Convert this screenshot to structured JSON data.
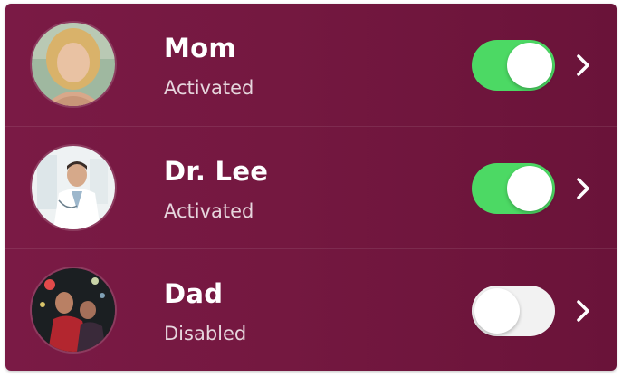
{
  "contacts": [
    {
      "name": "Mom",
      "status": "Activated",
      "enabled": true,
      "avatar_icon": "woman-portrait-icon"
    },
    {
      "name": "Dr. Lee",
      "status": "Activated",
      "enabled": true,
      "avatar_icon": "doctor-portrait-icon"
    },
    {
      "name": "Dad",
      "status": "Disabled",
      "enabled": false,
      "avatar_icon": "man-portrait-icon"
    }
  ],
  "colors": {
    "background": "#741840",
    "toggle_on": "#4cd964",
    "toggle_off": "#f2f2f2",
    "text": "#ffffff"
  },
  "icons": {
    "chevron": "chevron-right-icon"
  }
}
